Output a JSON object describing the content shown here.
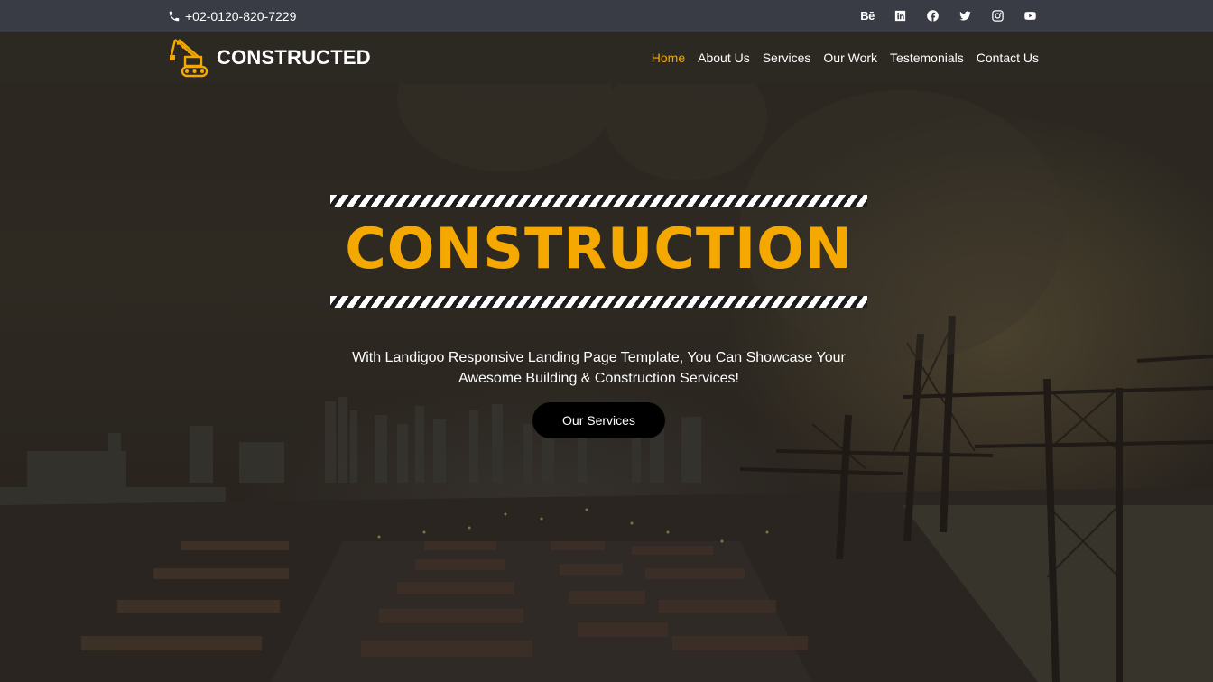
{
  "topbar": {
    "phone": "+02-0120-820-7229",
    "social_icons": [
      "behance-icon",
      "linkedin-icon",
      "facebook-icon",
      "twitter-icon",
      "instagram-icon",
      "youtube-icon"
    ],
    "behance_text": "Bē"
  },
  "navbar": {
    "brand": "CONSTRUCTED",
    "logo_icon": "crane-icon",
    "items": [
      {
        "label": "Home",
        "active": true
      },
      {
        "label": "About Us",
        "active": false
      },
      {
        "label": "Services",
        "active": false
      },
      {
        "label": "Our Work",
        "active": false
      },
      {
        "label": "Testemonials",
        "active": false
      },
      {
        "label": "Contact Us",
        "active": false
      }
    ]
  },
  "hero": {
    "headline": "CONSTRUCTION",
    "subtitle_line1": "With Landigoo Responsive Landing Page Template, You Can Showcase Your",
    "subtitle_line2": "Awesome Building & Construction Services!",
    "cta_label": "Our Services"
  },
  "colors": {
    "accent": "#f4a800",
    "topbar_bg": "#3a3c45",
    "navbar_bg": "#2d2924",
    "cta_bg": "#000000"
  }
}
